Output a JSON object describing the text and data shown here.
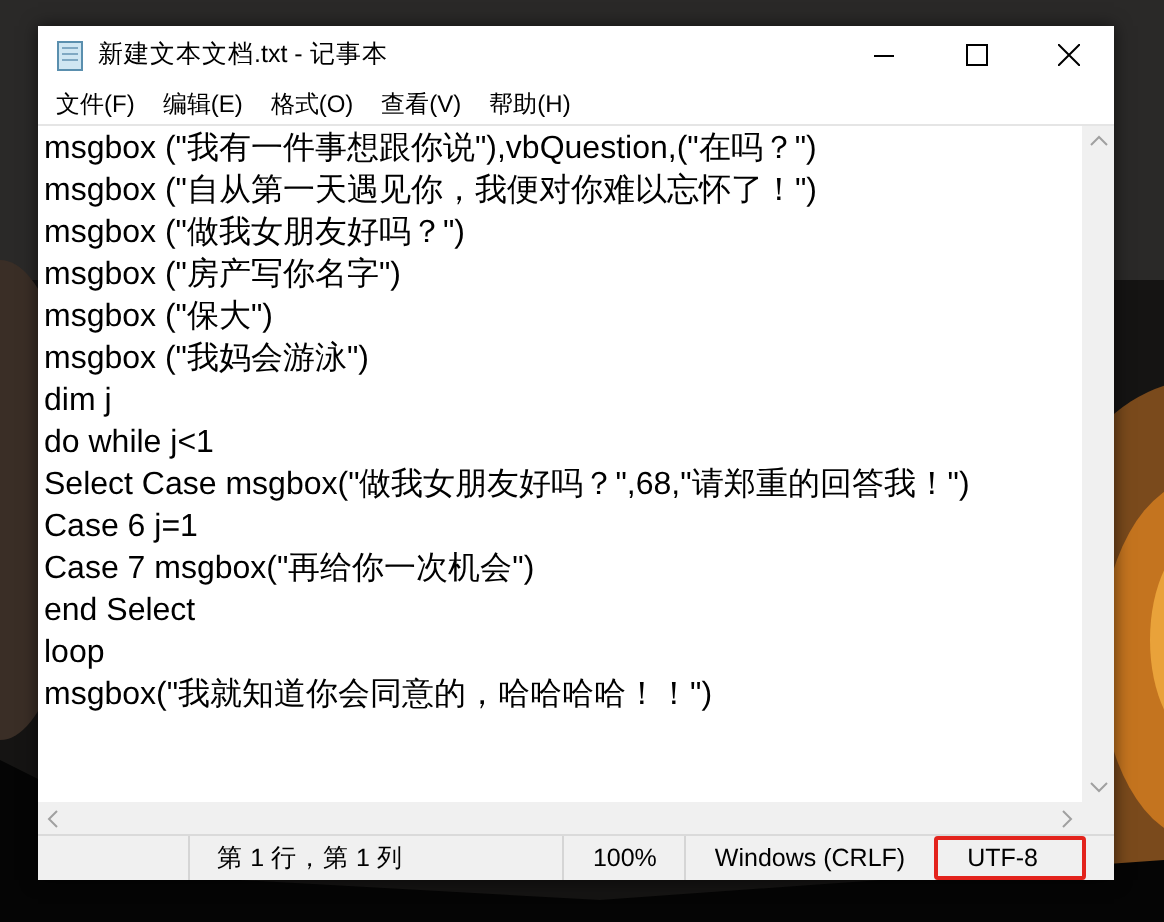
{
  "window": {
    "title": "新建文本文档.txt - 记事本"
  },
  "menu": [
    "文件(F)",
    "编辑(E)",
    "格式(O)",
    "查看(V)",
    "帮助(H)"
  ],
  "editor": {
    "lines": [
      "msgbox (\"我有一件事想跟你说\"),vbQuestion,(\"在吗？\")",
      "msgbox (\"自从第一天遇见你，我便对你难以忘怀了！\")",
      "msgbox (\"做我女朋友好吗？\")",
      "msgbox (\"房产写你名字\")",
      "msgbox (\"保大\")",
      "msgbox (\"我妈会游泳\")",
      "dim j",
      "do while j<1",
      "Select Case msgbox(\"做我女朋友好吗？\",68,\"请郑重的回答我！\")",
      "Case 6 j=1",
      "Case 7 msgbox(\"再给你一次机会\")",
      "end Select",
      "loop",
      "msgbox(\"我就知道你会同意的，哈哈哈哈！！\")"
    ]
  },
  "status_bar": [
    {
      "text": "第 1 行，第 1 列",
      "highlighted": false
    },
    {
      "text": "100%",
      "highlighted": false
    },
    {
      "text": "Windows (CRLF)",
      "highlighted": false
    },
    {
      "text": "UTF-8",
      "highlighted": true
    }
  ]
}
